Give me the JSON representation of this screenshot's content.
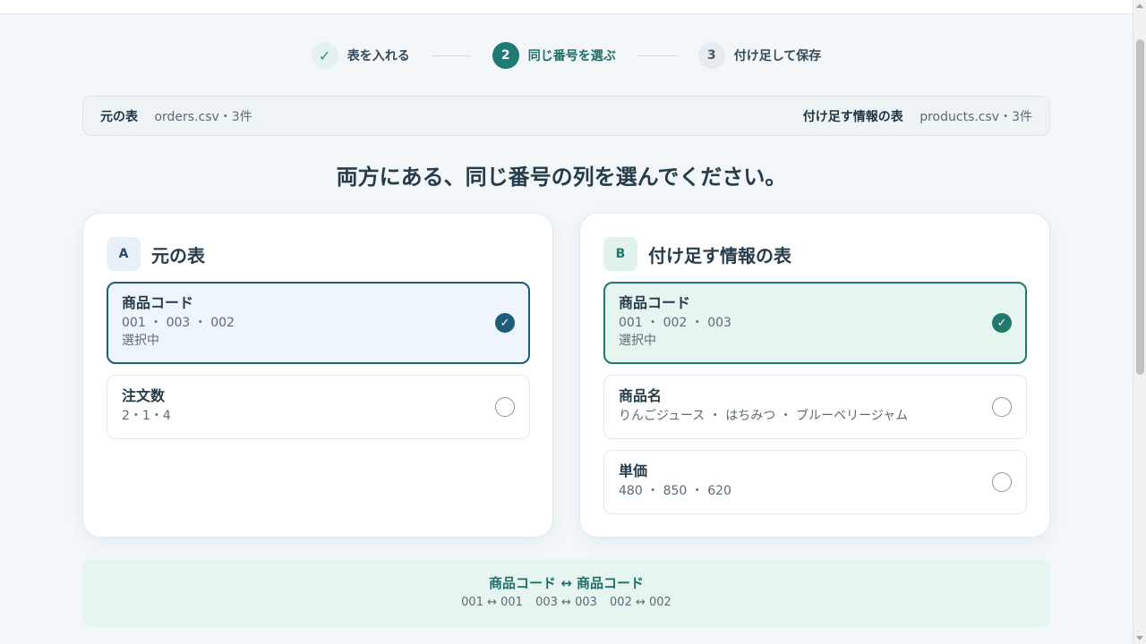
{
  "stepper": {
    "steps": [
      {
        "label": "表を入れる",
        "marker": "✓",
        "state": "done"
      },
      {
        "label": "同じ番号を選ぶ",
        "marker": "2",
        "state": "active"
      },
      {
        "label": "付け足して保存",
        "marker": "3",
        "state": "pending"
      }
    ]
  },
  "infobar": {
    "left_label": "元の表",
    "left_value": "orders.csv・3件",
    "right_label": "付け足す情報の表",
    "right_value": "products.csv・3件"
  },
  "heading": "両方にある、同じ番号の列を選んでください。",
  "panel_a": {
    "badge": "A",
    "title": "元の表",
    "options": [
      {
        "name": "商品コード",
        "values": "001 ・ 003 ・ 002",
        "status": "選択中",
        "selected": true
      },
      {
        "name": "注文数",
        "values": "2・1・4",
        "selected": false
      }
    ]
  },
  "panel_b": {
    "badge": "B",
    "title": "付け足す情報の表",
    "options": [
      {
        "name": "商品コード",
        "values": "001 ・ 002 ・ 003",
        "status": "選択中",
        "selected": true
      },
      {
        "name": "商品名",
        "values": "りんごジュース ・ はちみつ ・ ブルーベリージャム",
        "selected": false
      },
      {
        "name": "単価",
        "values": "480 ・ 850 ・ 620",
        "selected": false
      }
    ]
  },
  "mapping": {
    "title": "商品コード ↔ 商品コード",
    "pairs": [
      "001 ↔ 001",
      "003 ↔ 003",
      "002 ↔ 002"
    ]
  },
  "colors": {
    "accent": "#1f7a73",
    "selected_a_bg": "#eef5fd",
    "selected_b_bg": "#e6f5f0",
    "page_bg": "#f3f7fa"
  },
  "icons": {
    "done_step": "check-icon",
    "selected_option": "check-circle-icon",
    "unselected_option": "radio-empty-icon"
  }
}
